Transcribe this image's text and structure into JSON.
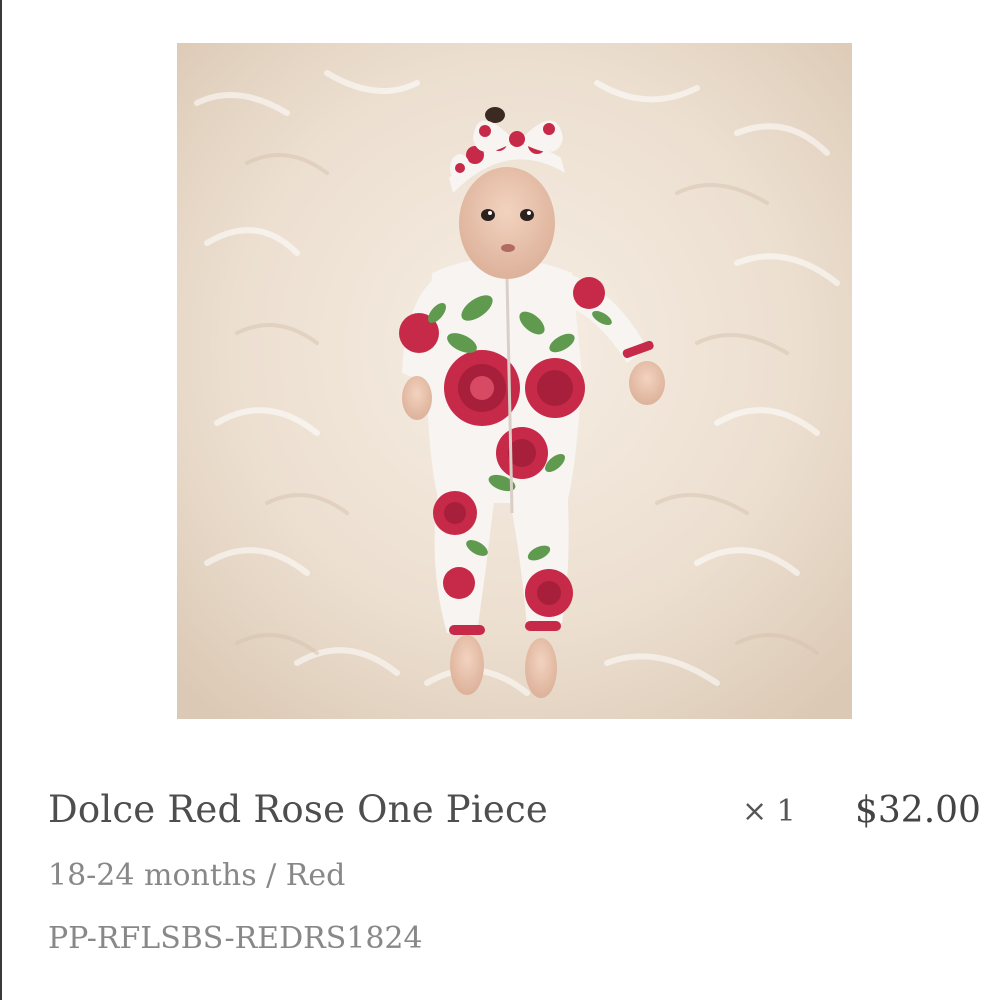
{
  "line_item": {
    "title": "Dolce Red Rose One Piece",
    "variant": "18-24 months / Red",
    "sku": "PP-RFLSBS-REDRS1824",
    "quantity": "× 1",
    "price": "$32.00"
  },
  "colors": {
    "photo_background": "#ece0d2",
    "rose_red": "#c62a48",
    "leaf_green": "#5f9a4e",
    "title_text": "#4e4e4e",
    "secondary_text": "#888888"
  }
}
